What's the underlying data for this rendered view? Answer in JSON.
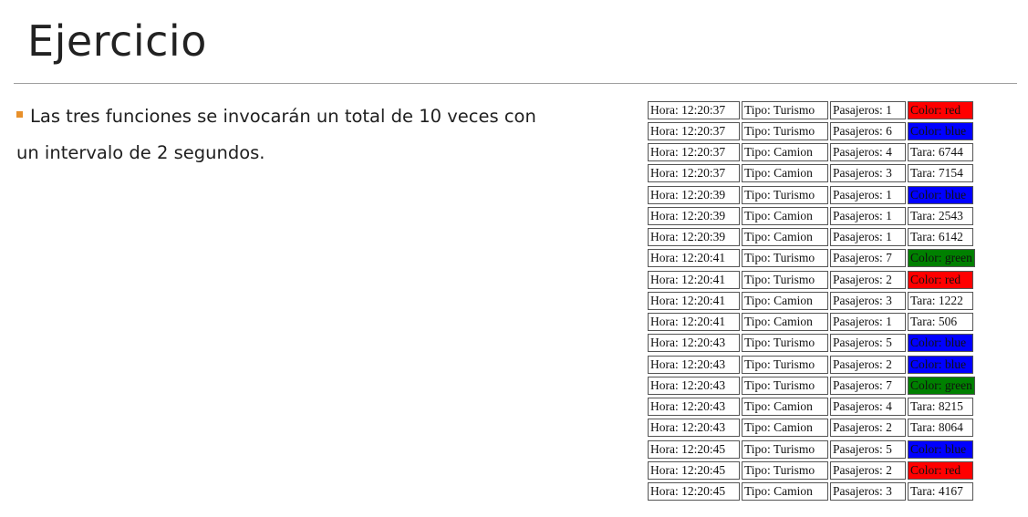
{
  "slide": {
    "title": "Ejercicio",
    "bullet_line1": "Las tres funciones se invocarán un total de 10 veces con",
    "bullet_line2": "un intervalo de 2 segundos.",
    "bullet_color": "#e8902a"
  },
  "rows": [
    {
      "hora": "Hora: 12:20:37",
      "tipo": "Tipo: Turismo",
      "pasajeros": "Pasajeros: 1",
      "extra": "Color: red",
      "bg": "#ff0000"
    },
    {
      "hora": "Hora: 12:20:37",
      "tipo": "Tipo: Turismo",
      "pasajeros": "Pasajeros: 6",
      "extra": "Color: blue",
      "bg": "#0000ff"
    },
    {
      "hora": "Hora: 12:20:37",
      "tipo": "Tipo: Camion",
      "pasajeros": "Pasajeros: 4",
      "extra": "Tara: 6744",
      "bg": ""
    },
    {
      "hora": "Hora: 12:20:37",
      "tipo": "Tipo: Camion",
      "pasajeros": "Pasajeros: 3",
      "extra": "Tara: 7154",
      "bg": ""
    },
    {
      "hora": "Hora: 12:20:39",
      "tipo": "Tipo: Turismo",
      "pasajeros": "Pasajeros: 1",
      "extra": "Color: blue",
      "bg": "#0000ff"
    },
    {
      "hora": "Hora: 12:20:39",
      "tipo": "Tipo: Camion",
      "pasajeros": "Pasajeros: 1",
      "extra": "Tara: 2543",
      "bg": ""
    },
    {
      "hora": "Hora: 12:20:39",
      "tipo": "Tipo: Camion",
      "pasajeros": "Pasajeros: 1",
      "extra": "Tara: 6142",
      "bg": ""
    },
    {
      "hora": "Hora: 12:20:41",
      "tipo": "Tipo: Turismo",
      "pasajeros": "Pasajeros: 7",
      "extra": "Color: green",
      "bg": "#008000"
    },
    {
      "hora": "Hora: 12:20:41",
      "tipo": "Tipo: Turismo",
      "pasajeros": "Pasajeros: 2",
      "extra": "Color: red",
      "bg": "#ff0000"
    },
    {
      "hora": "Hora: 12:20:41",
      "tipo": "Tipo: Camion",
      "pasajeros": "Pasajeros: 3",
      "extra": "Tara: 1222",
      "bg": ""
    },
    {
      "hora": "Hora: 12:20:41",
      "tipo": "Tipo: Camion",
      "pasajeros": "Pasajeros: 1",
      "extra": "Tara: 506",
      "bg": ""
    },
    {
      "hora": "Hora: 12:20:43",
      "tipo": "Tipo: Turismo",
      "pasajeros": "Pasajeros: 5",
      "extra": "Color: blue",
      "bg": "#0000ff"
    },
    {
      "hora": "Hora: 12:20:43",
      "tipo": "Tipo: Turismo",
      "pasajeros": "Pasajeros: 2",
      "extra": "Color: blue",
      "bg": "#0000ff"
    },
    {
      "hora": "Hora: 12:20:43",
      "tipo": "Tipo: Turismo",
      "pasajeros": "Pasajeros: 7",
      "extra": "Color: green",
      "bg": "#008000"
    },
    {
      "hora": "Hora: 12:20:43",
      "tipo": "Tipo: Camion",
      "pasajeros": "Pasajeros: 4",
      "extra": "Tara: 8215",
      "bg": ""
    },
    {
      "hora": "Hora: 12:20:43",
      "tipo": "Tipo: Camion",
      "pasajeros": "Pasajeros: 2",
      "extra": "Tara: 8064",
      "bg": ""
    },
    {
      "hora": "Hora: 12:20:45",
      "tipo": "Tipo: Turismo",
      "pasajeros": "Pasajeros: 5",
      "extra": "Color: blue",
      "bg": "#0000ff"
    },
    {
      "hora": "Hora: 12:20:45",
      "tipo": "Tipo: Turismo",
      "pasajeros": "Pasajeros: 2",
      "extra": "Color: red",
      "bg": "#ff0000"
    },
    {
      "hora": "Hora: 12:20:45",
      "tipo": "Tipo: Camion",
      "pasajeros": "Pasajeros: 3",
      "extra": "Tara: 4167",
      "bg": ""
    }
  ]
}
